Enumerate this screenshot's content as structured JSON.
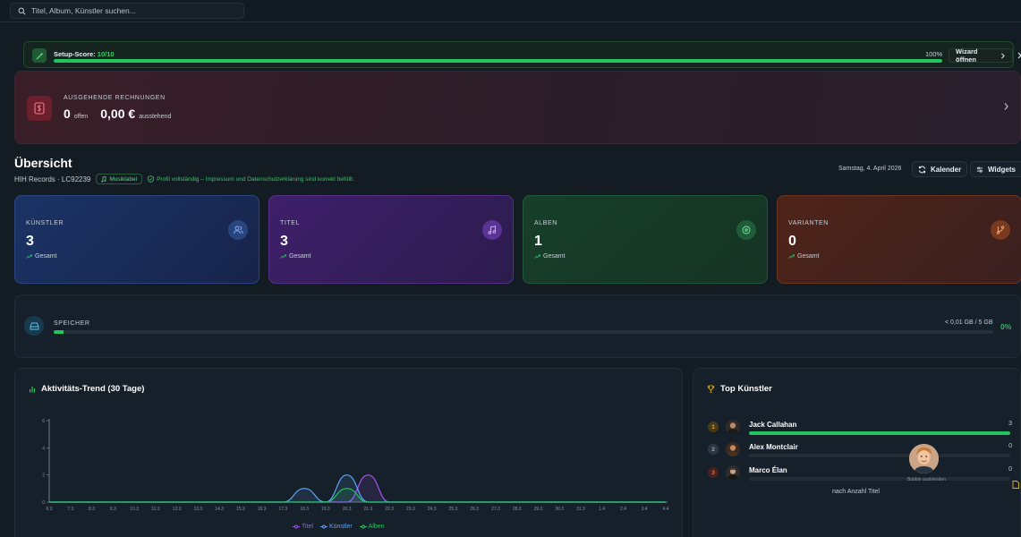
{
  "search": {
    "placeholder": "Titel, Album, Künstler suchen..."
  },
  "setup": {
    "label": "Setup-Score:",
    "score": "10/10",
    "percent_text": "100%",
    "progress": 1.0,
    "wizard_label": "Wizard öffnen"
  },
  "invoices": {
    "label": "AUSGEHENDE RECHNUNGEN",
    "open_count": "0",
    "open_label": "offen",
    "amount": "0,00 €",
    "amount_label": "ausstehend"
  },
  "overview": {
    "title": "Übersicht",
    "subtitle": "HIH Records · LC92239",
    "badge": "Musiklabel",
    "profile_status": "Profil vollständig – Impressum und Datenschutzerklärung sind korrekt befüllt.",
    "date": "Samstag, 4. April 2026",
    "calendar_label": "Kalender",
    "widgets_label": "Widgets"
  },
  "stats": [
    {
      "label": "KÜNSTLER",
      "value": "3",
      "sub": "Gesamt",
      "icon": "users-icon",
      "accent": "#5b8def"
    },
    {
      "label": "TITEL",
      "value": "3",
      "sub": "Gesamt",
      "icon": "music-icon",
      "accent": "#b07cf5"
    },
    {
      "label": "ALBEN",
      "value": "1",
      "sub": "Gesamt",
      "icon": "disc-icon",
      "accent": "#34d27a"
    },
    {
      "label": "VARIANTEN",
      "value": "0",
      "sub": "Gesamt",
      "icon": "branch-icon",
      "accent": "#f08a3c"
    }
  ],
  "storage": {
    "label": "SPEICHER",
    "used_text": "< 0,01 GB / 5 GB",
    "percent_text": "0%",
    "progress": 0.01
  },
  "trend": {
    "title": "Aktivitäts-Trend (30 Tage)",
    "legend": {
      "titel": "Titel",
      "kuenstler": "Künstler",
      "alben": "Alben"
    }
  },
  "chart_data": {
    "type": "area",
    "title": "Aktivitäts-Trend (30 Tage)",
    "x": [
      "6.3",
      "7.3",
      "8.3",
      "9.3",
      "10.3",
      "11.3",
      "12.3",
      "13.3",
      "14.3",
      "15.3",
      "16.3",
      "17.3",
      "18.3",
      "19.3",
      "20.3",
      "21.3",
      "22.3",
      "23.3",
      "24.3",
      "25.3",
      "26.3",
      "27.3",
      "28.3",
      "29.3",
      "30.3",
      "31.3",
      "1.4",
      "2.4",
      "3.4",
      "4.4"
    ],
    "y_ticks": [
      "0",
      "2",
      "4",
      "6"
    ],
    "ylim": [
      0,
      6
    ],
    "grid": false,
    "series": [
      {
        "name": "Titel",
        "color": "#a855f7",
        "values": [
          0,
          0,
          0,
          0,
          0,
          0,
          0,
          0,
          0,
          0,
          0,
          0,
          0,
          0,
          0,
          2,
          0,
          0,
          0,
          0,
          0,
          0,
          0,
          0,
          0,
          0,
          0,
          0,
          0,
          0
        ]
      },
      {
        "name": "Künstler",
        "color": "#60a5fa",
        "values": [
          0,
          0,
          0,
          0,
          0,
          0,
          0,
          0,
          0,
          0,
          0,
          0,
          1,
          0,
          2,
          0,
          0,
          0,
          0,
          0,
          0,
          0,
          0,
          0,
          0,
          0,
          0,
          0,
          0,
          0
        ]
      },
      {
        "name": "Alben",
        "color": "#22c55e",
        "values": [
          0,
          0,
          0,
          0,
          0,
          0,
          0,
          0,
          0,
          0,
          0,
          0,
          0,
          0,
          1,
          0,
          0,
          0,
          0,
          0,
          0,
          0,
          0,
          0,
          0,
          0,
          0,
          0,
          0,
          0
        ]
      }
    ]
  },
  "top_artists": {
    "title": "Top Künstler",
    "footer": "nach Anzahl Titel",
    "hide_label": "Bubble ausblenden",
    "items": [
      {
        "rank": "1",
        "name": "Jack Callahan",
        "count": "3",
        "share": 1.0,
        "rank_color": "#c9902a"
      },
      {
        "rank": "2",
        "name": "Alex Montclair",
        "count": "0",
        "share": 0.0,
        "rank_color": "#8a949e"
      },
      {
        "rank": "3",
        "name": "Marco Élan",
        "count": "0",
        "share": 0.0,
        "rank_color": "#c0503a"
      }
    ]
  }
}
